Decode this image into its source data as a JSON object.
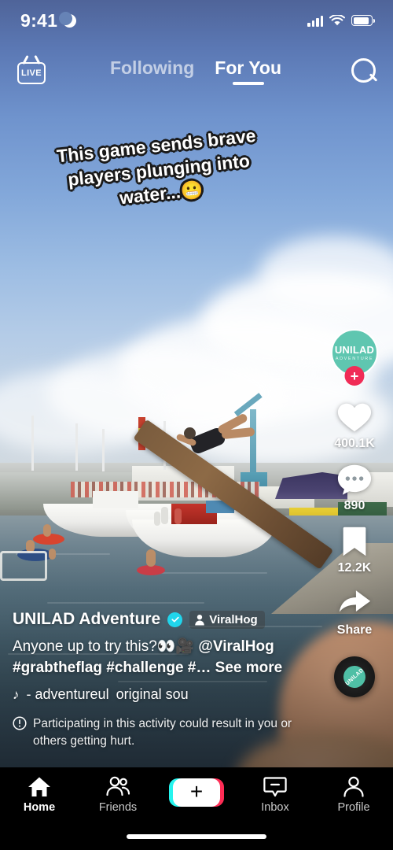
{
  "status_bar": {
    "time": "9:41",
    "dnd_icon": "crescent-moon-icon",
    "signal_icon": "cellular-bars-icon",
    "wifi_icon": "wifi-icon",
    "battery_icon": "battery-icon"
  },
  "top_nav": {
    "live_label": "LIVE",
    "tabs": [
      {
        "label": "Following",
        "active": false
      },
      {
        "label": "For You",
        "active": true
      }
    ],
    "search_icon": "search-icon"
  },
  "video": {
    "sticker_text": "This game sends brave players plunging into water...😬",
    "scene_description": "harbor greasy-pole diving"
  },
  "action_rail": {
    "avatar": {
      "name_line1": "UNILAD",
      "name_line2": "ADVENTURE",
      "color": "#5fc6b0",
      "follow_label": "+",
      "follow_color": "#f02c56"
    },
    "like": {
      "icon": "heart-icon",
      "count": "400.1K"
    },
    "comment": {
      "icon": "comment-icon",
      "count": "890"
    },
    "bookmark": {
      "icon": "bookmark-icon",
      "count": "12.2K"
    },
    "share": {
      "icon": "share-arrow-icon",
      "label": "Share"
    },
    "disc": {
      "icon": "music-disc-icon",
      "label": "UNILAD"
    }
  },
  "post_info": {
    "username": "UNILAD Adventure",
    "verified_icon": "verified-check-icon",
    "source_tag": {
      "icon": "person-icon",
      "label": "ViralHog"
    },
    "caption_text": "Anyone up to try this?👀🎥 ",
    "caption_mention": "@ViralHog",
    "hashtags": "#grabtheflag #challenge #…",
    "see_more": "See more",
    "music_note_icon": "music-note-icon",
    "music_author": "- adventureul",
    "music_title": "original sou",
    "warning_icon": "warning-circle-icon",
    "warning_text": "Participating in this activity could result in you or others getting hurt."
  },
  "tab_bar": {
    "items": [
      {
        "label": "Home",
        "icon": "home-icon",
        "active": true
      },
      {
        "label": "Friends",
        "icon": "friends-icon",
        "active": false
      },
      {
        "label": "Inbox",
        "icon": "inbox-icon",
        "active": false
      },
      {
        "label": "Profile",
        "icon": "profile-icon",
        "active": false
      }
    ],
    "create_label": "+"
  }
}
